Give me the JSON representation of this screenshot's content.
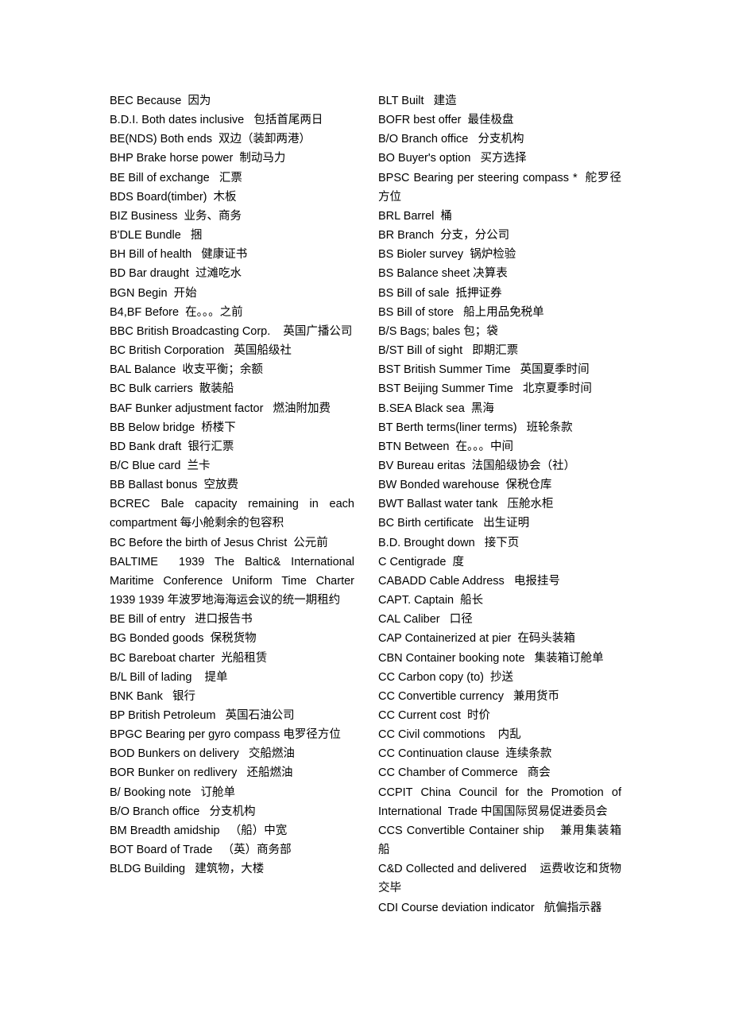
{
  "left_column": [
    "BEC Because  因为",
    "B.D.I. Both dates inclusive   包括首尾两日",
    "BE(NDS) Both ends  双边（装卸两港）",
    "BHP Brake horse power  制动马力",
    "BE Bill of exchange   汇票",
    "BDS Board(timber)  木板",
    "BIZ Business  业务、商务",
    "B'DLE Bundle   捆",
    "BH Bill of health   健康证书",
    "BD Bar draught  过滩吃水",
    "BGN Begin  开始",
    "B4,BF Before  在。。。之前",
    "BBC British Broadcasting Corp.    英国广播公司",
    "BC British Corporation   英国船级社",
    "BAL Balance  收支平衡；余额",
    "BC Bulk carriers  散装船",
    "BAF Bunker adjustment factor   燃油附加费",
    "BB Below bridge  桥楼下",
    "BD Bank draft  银行汇票",
    "B/C Blue card  兰卡",
    "BB Ballast bonus  空放费",
    "BCREC Bale capacity remaining in each compartment 每小舱剩余的包容积",
    "BC Before the birth of Jesus Christ  公元前",
    "BALTIME  1939 The Baltic& International Maritime Conference Uniform Time Charter 1939 1939 年波罗地海海运会议的统一期租约",
    "BE Bill of entry   进口报告书",
    "BG Bonded goods  保税货物",
    "BC Bareboat charter  光船租赁",
    "B/L Bill of lading    提单",
    "BNK Bank   银行",
    "BP British Petroleum   英国石油公司",
    "BPGC Bearing per gyro compass 电罗径方位",
    "BOD Bunkers on delivery   交船燃油",
    "BOR Bunker on redlivery   还船燃油",
    "B/ Booking note   订舱单",
    "B/O Branch office   分支机构",
    "BM Breadth amidship   （船）中宽",
    "BOT Board of Trade   （英）商务部",
    "BLDG Building   建筑物，大楼"
  ],
  "right_column": [
    "BLT Built   建造",
    "BOFR best offer  最佳极盘",
    "B/O Branch office   分支机构",
    "BO Buyer's option   买方选择",
    "BPSC Bearing per steering compass *  舵罗径方位",
    "BRL Barrel  桶",
    "BR Branch  分支，分公司",
    "BS Bioler survey  锅炉检验",
    "BS Balance sheet 决算表",
    "BS Bill of sale  抵押证券",
    "BS Bill of store   船上用品免税单",
    "B/S Bags; bales 包；袋",
    "B/ST Bill of sight   即期汇票",
    "BST British Summer Time   英国夏季时间",
    "BST Beijing Summer Time   北京夏季时间",
    "B.SEA Black sea  黑海",
    "BT Berth terms(liner terms)   班轮条款",
    "BTN Between  在。。。中间",
    "BV Bureau eritas  法国船级协会（社）",
    "BW Bonded warehouse  保税仓库",
    "BWT Ballast water tank   压舱水柜",
    "BC Birth certificate   出生证明",
    "B.D. Brought down   接下页",
    "C Centigrade  度",
    "CABADD Cable Address   电报挂号",
    "CAPT. Captain  船长",
    "CAL Caliber   口径",
    "CAP Containerized at pier  在码头装箱",
    "CBN Container booking note   集装箱订舱单",
    "CC Carbon copy (to)  抄送",
    "CC Convertible currency   兼用货币",
    "CC Current cost  时价",
    "CC Civil commotions    内乱",
    "CC Continuation clause  连续条款",
    "CC Chamber of Commerce   商会",
    "CCPIT China Council for the Promotion of International  Trade 中国国际贸易促进委员会",
    "CCS Convertible Container ship    兼用集装箱船",
    "C&D Collected and delivered    运费收讫和货物交毕",
    "CDI Course deviation indicator   航偏指示器"
  ]
}
